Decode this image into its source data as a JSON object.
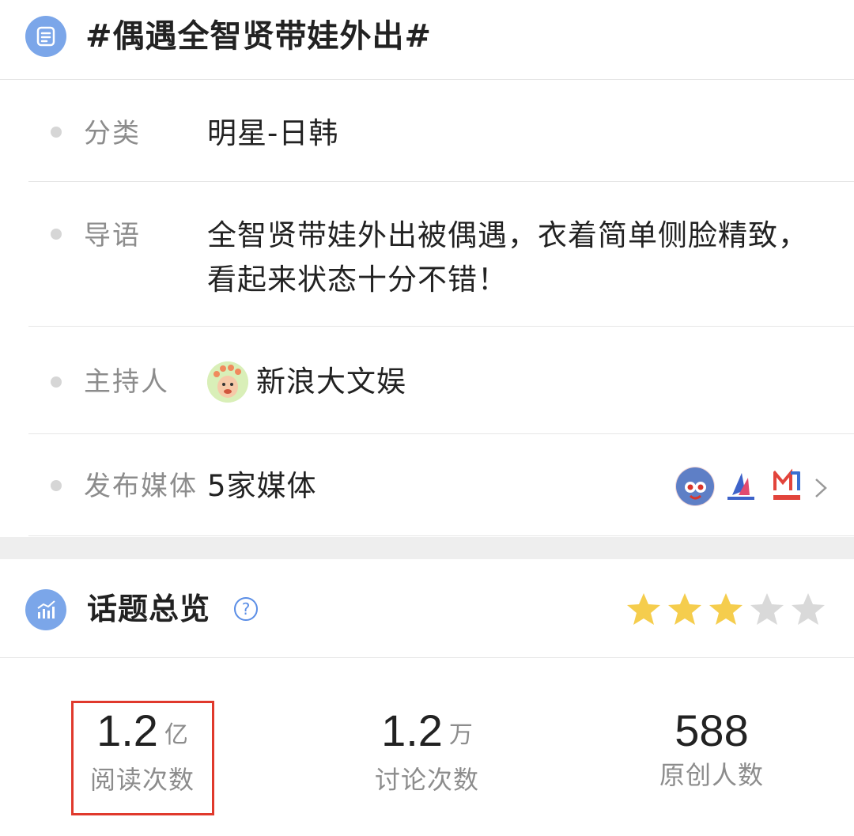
{
  "header": {
    "title": "#偶遇全智贤带娃外出#",
    "icon": "list-icon"
  },
  "info": {
    "category": {
      "label": "分类",
      "value": "明星-日韩"
    },
    "intro": {
      "label": "导语",
      "value": "全智贤带娃外出被偶遇，衣着简单侧脸精致，看起来状态十分不错！"
    },
    "host": {
      "label": "主持人",
      "value": "新浪大文娱",
      "avatar": "host-avatar"
    },
    "media": {
      "label": "发布媒体",
      "value": "5家媒体",
      "logos": [
        "新浪韩娱",
        "东方网娱乐",
        "海外剧"
      ]
    }
  },
  "overview": {
    "title": "话题总览",
    "icon": "bar-chart-icon",
    "help_icon": "question-icon",
    "rating": 3,
    "rating_max": 5,
    "colors": {
      "star_on": "#f5cd4d",
      "star_off": "#d9d9d9",
      "accent": "#7ba6e9",
      "highlight": "#e0392c"
    }
  },
  "stats": {
    "read": {
      "value": "1.2",
      "unit": "亿",
      "label": "阅读次数"
    },
    "discuss": {
      "value": "1.2",
      "unit": "万",
      "label": "讨论次数"
    },
    "original": {
      "value": "588",
      "unit": "",
      "label": "原创人数"
    }
  }
}
